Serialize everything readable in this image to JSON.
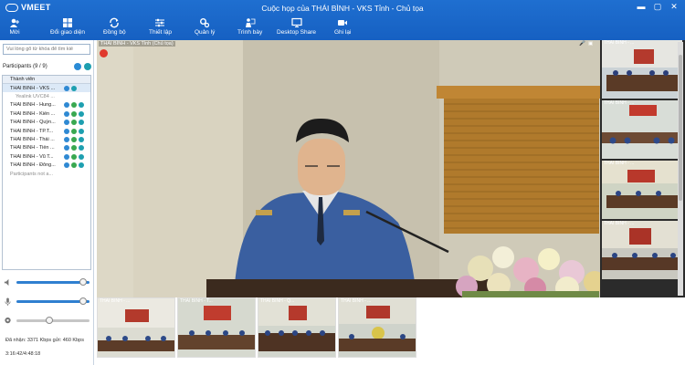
{
  "app": {
    "logo": "VMEET",
    "title": "Cuộc họp của THÁI BÌNH - VKS Tỉnh - Chủ tọa"
  },
  "colors": {
    "titlebar": "#1f6fd0",
    "accent_blue": "#2f89d3",
    "accent_green": "#39a850"
  },
  "toolbar": {
    "items": [
      {
        "label": "Mời",
        "icon": "person-add-icon"
      },
      {
        "label": "Đổi giao diện",
        "icon": "layout-icon"
      },
      {
        "label": "Đồng bộ",
        "icon": "sync-icon"
      },
      {
        "label": "Thiết lập",
        "icon": "settings-sliders-icon"
      },
      {
        "label": "Quản lý",
        "icon": "gears-icon"
      },
      {
        "label": "Trình bày",
        "icon": "presenter-icon"
      },
      {
        "label": "Desktop Share",
        "icon": "monitor-icon"
      },
      {
        "label": "Ghi lại",
        "icon": "video-record-icon"
      }
    ]
  },
  "left": {
    "search_placeholder": "Vui lòng gõ từ khóa để tìm kiế",
    "participants_label": "Participants (9 / 9)",
    "column_header": "Thành viên",
    "participants": [
      {
        "name": "THÁI BÌNH - VKS ...",
        "type": "selected"
      },
      {
        "name": "Yealink UVC84 ...",
        "type": "sub"
      },
      {
        "name": "THÁI BÌNH - Hung...",
        "type": "normal"
      },
      {
        "name": "THÁI BÌNH - Kiến ...",
        "type": "normal"
      },
      {
        "name": "THÁI BÌNH - Quỳn...",
        "type": "normal"
      },
      {
        "name": "THÁI BÌNH - TP.T...",
        "type": "normal"
      },
      {
        "name": "THÁI BÌNH - Thái ...",
        "type": "normal"
      },
      {
        "name": "THÁI BÌNH - Tiền ...",
        "type": "normal"
      },
      {
        "name": "THÁI BÌNH - Vũ T...",
        "type": "normal"
      },
      {
        "name": "THÁI BÌNH - Đông...",
        "type": "normal"
      },
      {
        "name": "Participants not a...",
        "type": "dim"
      }
    ],
    "speaker_level": 0.96,
    "mic_level": 0.96,
    "camera_level": 0.45,
    "bandwidth": "Đã nhận: 3371 Kbps gửi: 460 Kbps",
    "time": "3:16:42/4:48:18"
  },
  "main_video": {
    "label": "THÁI BÌNH - VKS Tỉnh (Chủ tọa)"
  },
  "right_thumbs": [
    {
      "label": "THÁI BÌNH - ..."
    },
    {
      "label": "THÁI BÌNH - ..."
    },
    {
      "label": "THÁI BÌNH - ..."
    },
    {
      "label": "THÁI BÌNH - ..."
    }
  ],
  "bottom_thumbs": [
    {
      "label": "THÁI BÌNH - ..."
    },
    {
      "label": "THÁI BÌNH - T..."
    },
    {
      "label": "THÁI BÌNH - Q..."
    },
    {
      "label": "THÁI BÌNH - ..."
    }
  ]
}
